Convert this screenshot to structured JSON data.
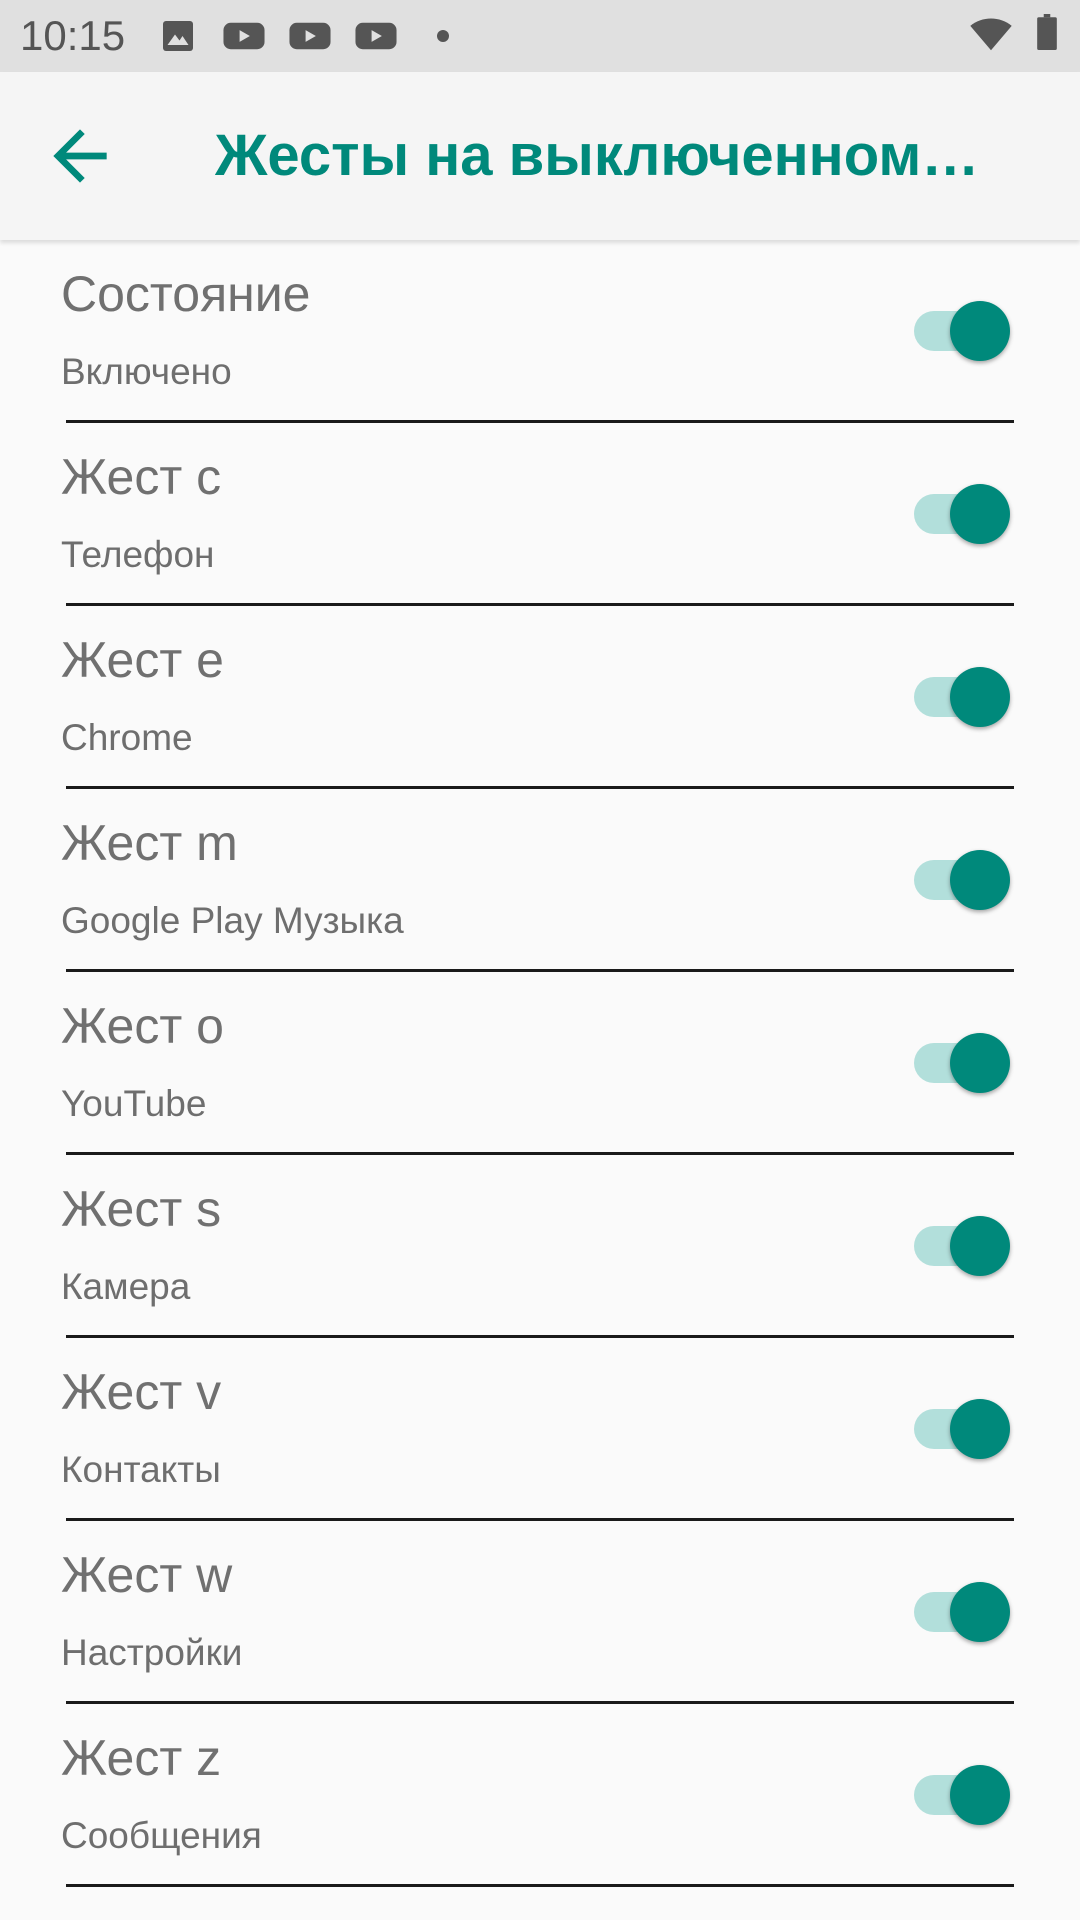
{
  "status_bar": {
    "time": "10:15",
    "notification_icons": [
      "image-icon",
      "youtube-icon",
      "youtube-icon",
      "youtube-icon",
      "dot-icon"
    ],
    "system_icons": [
      "wifi-icon",
      "battery-icon"
    ]
  },
  "app_bar": {
    "back_icon": "arrow-back-icon",
    "title": "Жесты на выключенном…"
  },
  "colors": {
    "accent": "#00897b",
    "track_on": "#b2dfdb",
    "text_secondary": "#707070"
  },
  "items": [
    {
      "title": "Состояние",
      "summary": "Включено",
      "checked": true
    },
    {
      "title": "Жест c",
      "summary": "Телефон",
      "checked": true
    },
    {
      "title": "Жест e",
      "summary": "Chrome",
      "checked": true
    },
    {
      "title": "Жест m",
      "summary": "Google Play Музыка",
      "checked": true
    },
    {
      "title": "Жест o",
      "summary": "YouTube",
      "checked": true
    },
    {
      "title": "Жест s",
      "summary": "Камера",
      "checked": true
    },
    {
      "title": "Жест v",
      "summary": "Контакты",
      "checked": true
    },
    {
      "title": "Жест w",
      "summary": "Настройки",
      "checked": true
    },
    {
      "title": "Жест z",
      "summary": "Сообщения",
      "checked": true
    }
  ]
}
